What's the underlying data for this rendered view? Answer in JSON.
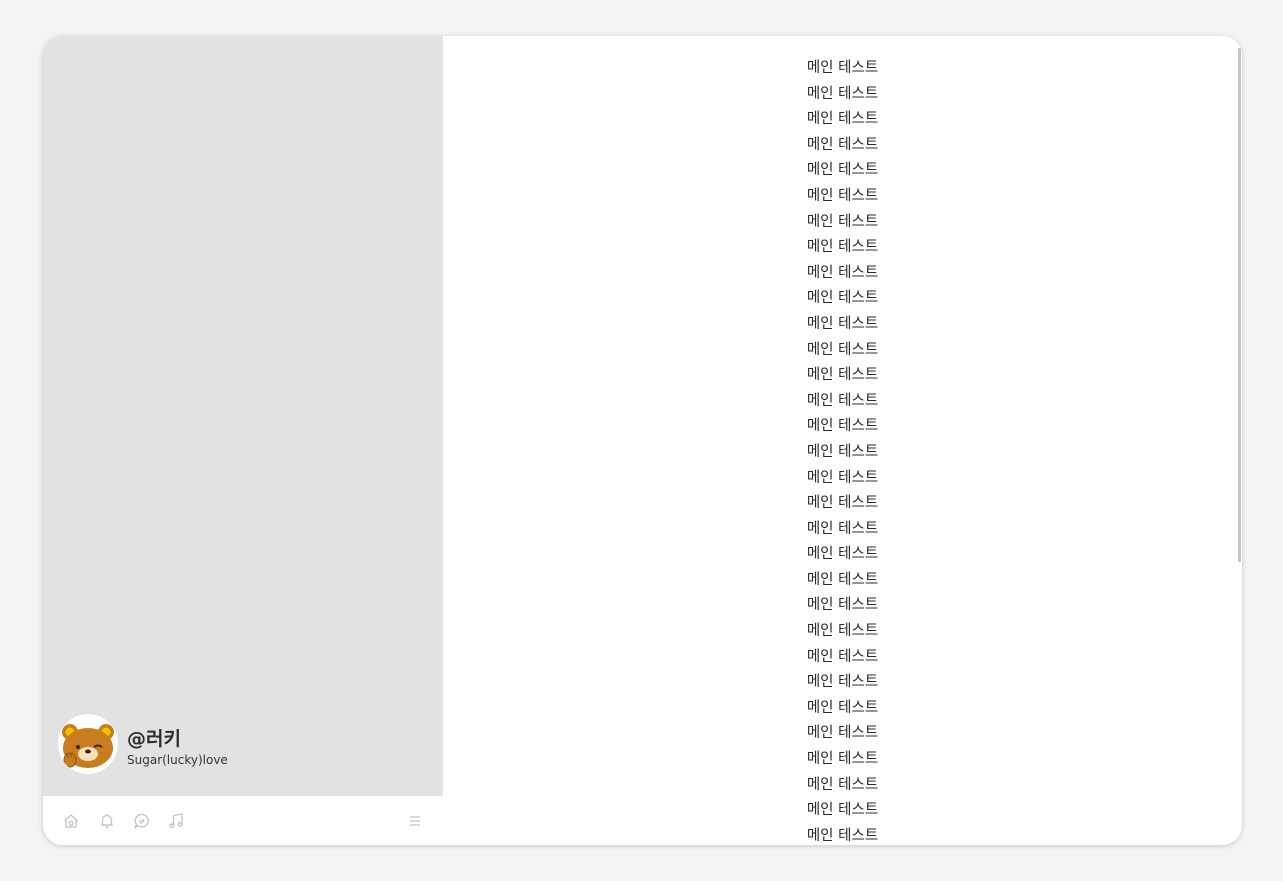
{
  "sidebar": {
    "profile": {
      "username": "@러키",
      "status": "Sugar(lucky)love"
    },
    "nav": {
      "icons": [
        "home-icon",
        "bell-icon",
        "chat-icon",
        "music-icon",
        "menu-icon"
      ]
    }
  },
  "main": {
    "lines": [
      "메인 테스트",
      "메인 테스트",
      "메인 테스트",
      "메인 테스트",
      "메인 테스트",
      "메인 테스트",
      "메인 테스트",
      "메인 테스트",
      "메인 테스트",
      "메인 테스트",
      "메인 테스트",
      "메인 테스트",
      "메인 테스트",
      "메인 테스트",
      "메인 테스트",
      "메인 테스트",
      "메인 테스트",
      "메인 테스트",
      "메인 테스트",
      "메인 테스트",
      "메인 테스트",
      "메인 테스트",
      "메인 테스트",
      "메인 테스트",
      "메인 테스트",
      "메인 테스트",
      "메인 테스트",
      "메인 테스트",
      "메인 테스트",
      "메인 테스트",
      "메인 테스트"
    ]
  },
  "colors": {
    "page_background": "#f4f4f4",
    "sidebar_background": "#e2e2e2",
    "panel_background": "#ffffff",
    "icon_color": "#c2c2c2",
    "text_color": "#2b2b2b"
  }
}
